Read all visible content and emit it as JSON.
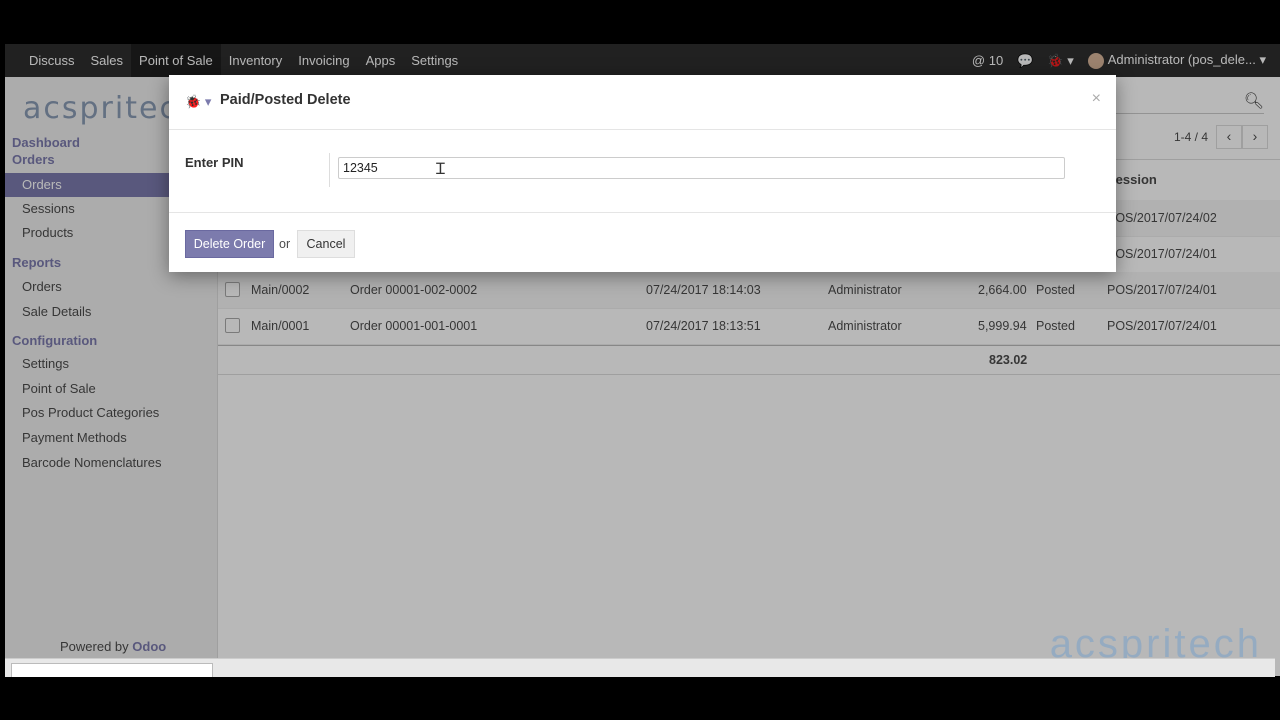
{
  "navbar": {
    "menu": [
      "Discuss",
      "Sales",
      "Point of Sale",
      "Inventory",
      "Invoicing",
      "Apps",
      "Settings"
    ],
    "active": "Point of Sale",
    "notifications": "10",
    "user": "Administrator (pos_dele..."
  },
  "sidebar": {
    "logo": "acspritech",
    "sections": {
      "dashboard": "Dashboard",
      "orders": "Orders",
      "reports": "Reports",
      "configuration": "Configuration"
    },
    "order_items": [
      "Orders",
      "Sessions",
      "Products"
    ],
    "report_items": [
      "Orders",
      "Sale Details"
    ],
    "config_items": [
      "Settings",
      "Point of Sale",
      "Pos Product Categories",
      "Payment Methods",
      "Barcode Nomenclatures"
    ],
    "powered_prefix": "Powered by",
    "powered_brand": "Odoo"
  },
  "list": {
    "pager": "1-4 / 4",
    "header_session": "Session",
    "rows": [
      {
        "ref": "",
        "name": "",
        "date": "",
        "user": "",
        "amount": "",
        "state": "",
        "session": "POS/2017/07/24/02"
      },
      {
        "ref": "",
        "name": "",
        "date": "",
        "user": "",
        "amount": "",
        "state": "",
        "session": "POS/2017/07/24/01"
      },
      {
        "ref": "Main/0002",
        "name": "Order 00001-002-0002",
        "date": "07/24/2017 18:14:03",
        "user": "Administrator",
        "amount": "2,664.00",
        "state": "Posted",
        "session": "POS/2017/07/24/01"
      },
      {
        "ref": "Main/0001",
        "name": "Order 00001-001-0001",
        "date": "07/24/2017 18:13:51",
        "user": "Administrator",
        "amount": "5,999.94",
        "state": "Posted",
        "session": "POS/2017/07/24/01"
      }
    ],
    "total": "823.02"
  },
  "dialog": {
    "title": "Paid/Posted Delete",
    "pin_label": "Enter PIN",
    "pin_value": "12345",
    "delete_label": "Delete Order",
    "or_text": "or",
    "cancel_label": "Cancel"
  },
  "watermark": "acspritech"
}
